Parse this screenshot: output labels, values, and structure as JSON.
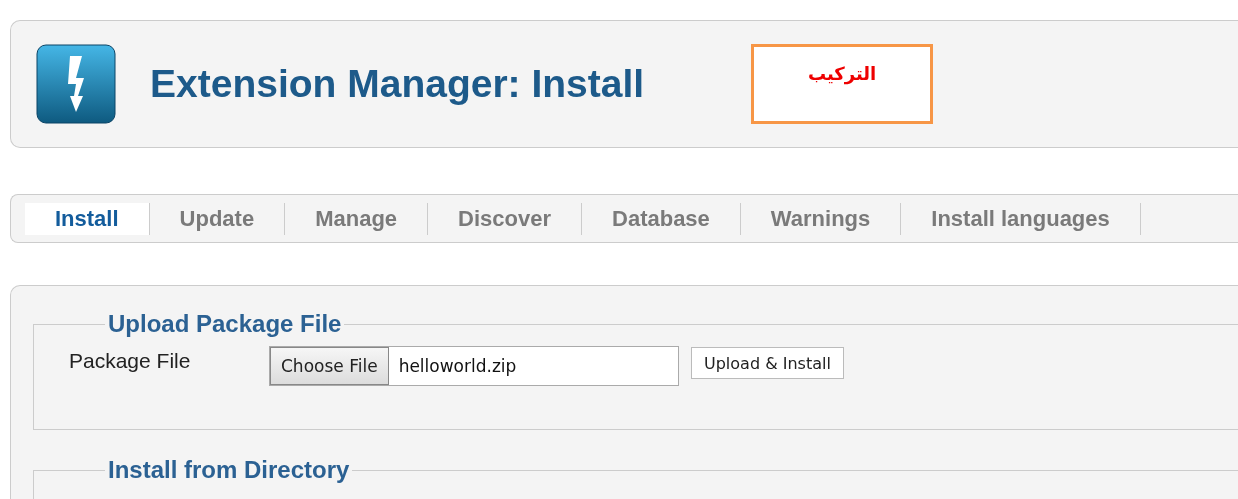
{
  "header": {
    "title": "Extension Manager: Install",
    "annotation": "التركيب"
  },
  "tabs": [
    {
      "label": "Install",
      "selected": true
    },
    {
      "label": "Update",
      "selected": false
    },
    {
      "label": "Manage",
      "selected": false
    },
    {
      "label": "Discover",
      "selected": false
    },
    {
      "label": "Database",
      "selected": false
    },
    {
      "label": "Warnings",
      "selected": false
    },
    {
      "label": "Install languages",
      "selected": false
    }
  ],
  "sections": [
    {
      "kind": "upload",
      "legend": "Upload Package File",
      "field_label": "Package File",
      "choose_button": "Choose File",
      "file_name": "helloworld.zip",
      "submit_button": "Upload & Install"
    },
    {
      "kind": "directory",
      "legend": "Install from Directory"
    }
  ]
}
